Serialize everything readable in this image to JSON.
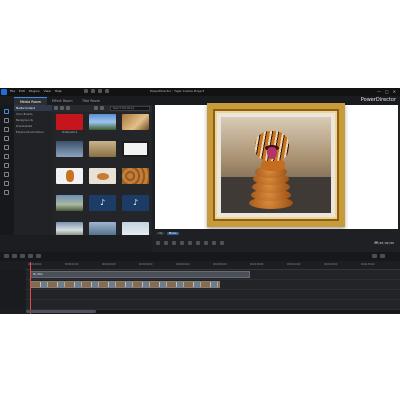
{
  "window": {
    "menu": [
      "File",
      "Edit",
      "Plugins",
      "View",
      "Help"
    ],
    "project_title": "PowerDirector - Tiger Cookie Project",
    "brand": "PowerDirector",
    "controls": [
      "—",
      "□",
      "✕"
    ]
  },
  "tabs": [
    {
      "label": "Media Room",
      "active": true
    },
    {
      "label": "Effect Room",
      "active": false
    },
    {
      "label": "Title Room",
      "active": false
    }
  ],
  "left_nav_icons": [
    "media-room-icon",
    "effect-room-icon",
    "pip-icon",
    "particle-icon",
    "title-icon",
    "transition-icon",
    "audio-mix-icon",
    "voice-over-icon",
    "chapter-icon",
    "subtitle-icon"
  ],
  "tree": {
    "items": [
      "Media Content",
      "Color Boards",
      "Backgrounds",
      "Downloaded",
      "Explore DirectorZone"
    ],
    "selected_index": 0
  },
  "library": {
    "search_placeholder": "Search the library",
    "items": [
      {
        "caption": "Shutterstock",
        "icon": "shutterstock-icon"
      },
      {
        "caption": "",
        "icon": "landscape-icon"
      },
      {
        "caption": "",
        "icon": "food-icon"
      },
      {
        "caption": "",
        "icon": "city-icon"
      },
      {
        "caption": "",
        "icon": "desert-icon"
      },
      {
        "caption": "",
        "icon": "frame-icon"
      },
      {
        "caption": "",
        "icon": "tiger-icon"
      },
      {
        "caption": "",
        "icon": "cookie-icon"
      },
      {
        "caption": "",
        "icon": "cookies-icon"
      },
      {
        "caption": "",
        "icon": "landscape-icon"
      },
      {
        "caption": "",
        "icon": "music-icon"
      },
      {
        "caption": "",
        "icon": "music-icon"
      },
      {
        "caption": "",
        "icon": "mountain-icon"
      },
      {
        "caption": "",
        "icon": "lake-icon"
      },
      {
        "caption": "",
        "icon": "snow-icon"
      },
      {
        "caption": "",
        "icon": "sky-icon"
      },
      {
        "caption": "",
        "icon": "sky-icon"
      },
      {
        "caption": "",
        "icon": "sky-icon"
      }
    ]
  },
  "preview": {
    "mode_buttons": [
      "Clip",
      "Movie"
    ],
    "active_mode": "Movie",
    "fit_label": "Fit",
    "timecode": "00;00;00;00"
  },
  "timeline": {
    "ruler_ticks": [
      "00;00;00;00",
      "00;00;10;00",
      "00;00;20;00",
      "00;00;30;00",
      "00;00;40;00",
      "00;00;50;00",
      "00;01;00;00",
      "00;01;10;00",
      "00;01;20;00",
      "00;01;30;00"
    ],
    "tracks": [
      {
        "type": "title",
        "label": "My title"
      },
      {
        "type": "video",
        "label": ""
      },
      {
        "type": "audio",
        "label": ""
      }
    ]
  }
}
